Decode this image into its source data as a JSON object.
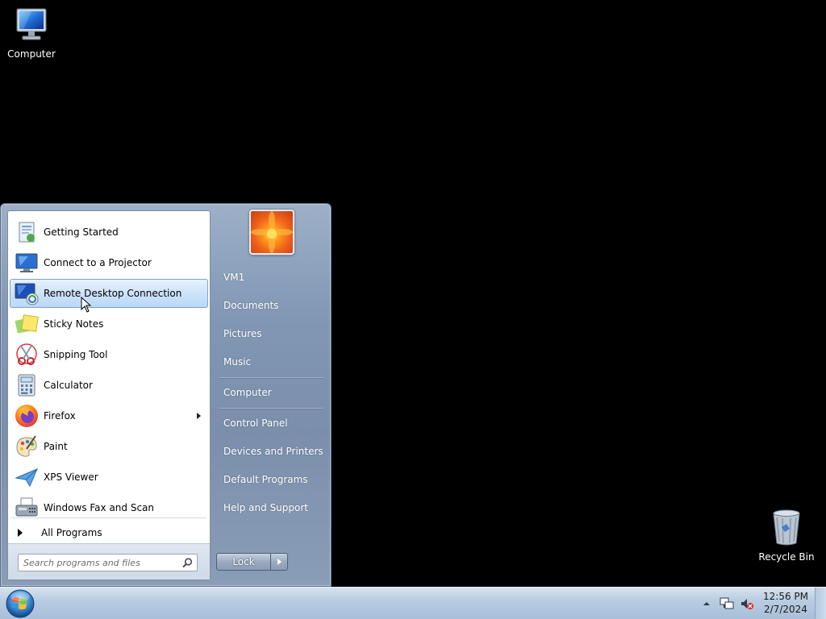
{
  "desktop": {
    "icons": [
      {
        "label": "Computer",
        "icon": "computer-icon"
      },
      {
        "label": "Recycle Bin",
        "icon": "recycle-bin-icon"
      }
    ]
  },
  "start_menu": {
    "programs": [
      {
        "label": "Getting Started",
        "icon": "getting-started-icon"
      },
      {
        "label": "Connect to a Projector",
        "icon": "projector-icon"
      },
      {
        "label": "Remote Desktop Connection",
        "icon": "remote-desktop-icon",
        "highlighted": true
      },
      {
        "label": "Sticky Notes",
        "icon": "sticky-notes-icon"
      },
      {
        "label": "Snipping Tool",
        "icon": "scissors-icon"
      },
      {
        "label": "Calculator",
        "icon": "calculator-icon"
      },
      {
        "label": "Firefox",
        "icon": "firefox-icon",
        "has_submenu": true
      },
      {
        "label": "Paint",
        "icon": "paint-palette-icon"
      },
      {
        "label": "XPS Viewer",
        "icon": "xps-viewer-icon"
      },
      {
        "label": "Windows Fax and Scan",
        "icon": "fax-icon"
      }
    ],
    "all_programs_label": "All Programs",
    "search_placeholder": "Search programs and files",
    "right_items": [
      {
        "label": "VM1"
      },
      {
        "label": "Documents"
      },
      {
        "label": "Pictures"
      },
      {
        "label": "Music"
      },
      {
        "label": "Computer"
      },
      {
        "label": "Control Panel"
      },
      {
        "label": "Devices and Printers"
      },
      {
        "label": "Default Programs"
      },
      {
        "label": "Help and Support"
      }
    ],
    "lock_label": "Lock"
  },
  "taskbar": {
    "clock_time": "12:56 PM",
    "clock_date": "2/7/2024"
  }
}
